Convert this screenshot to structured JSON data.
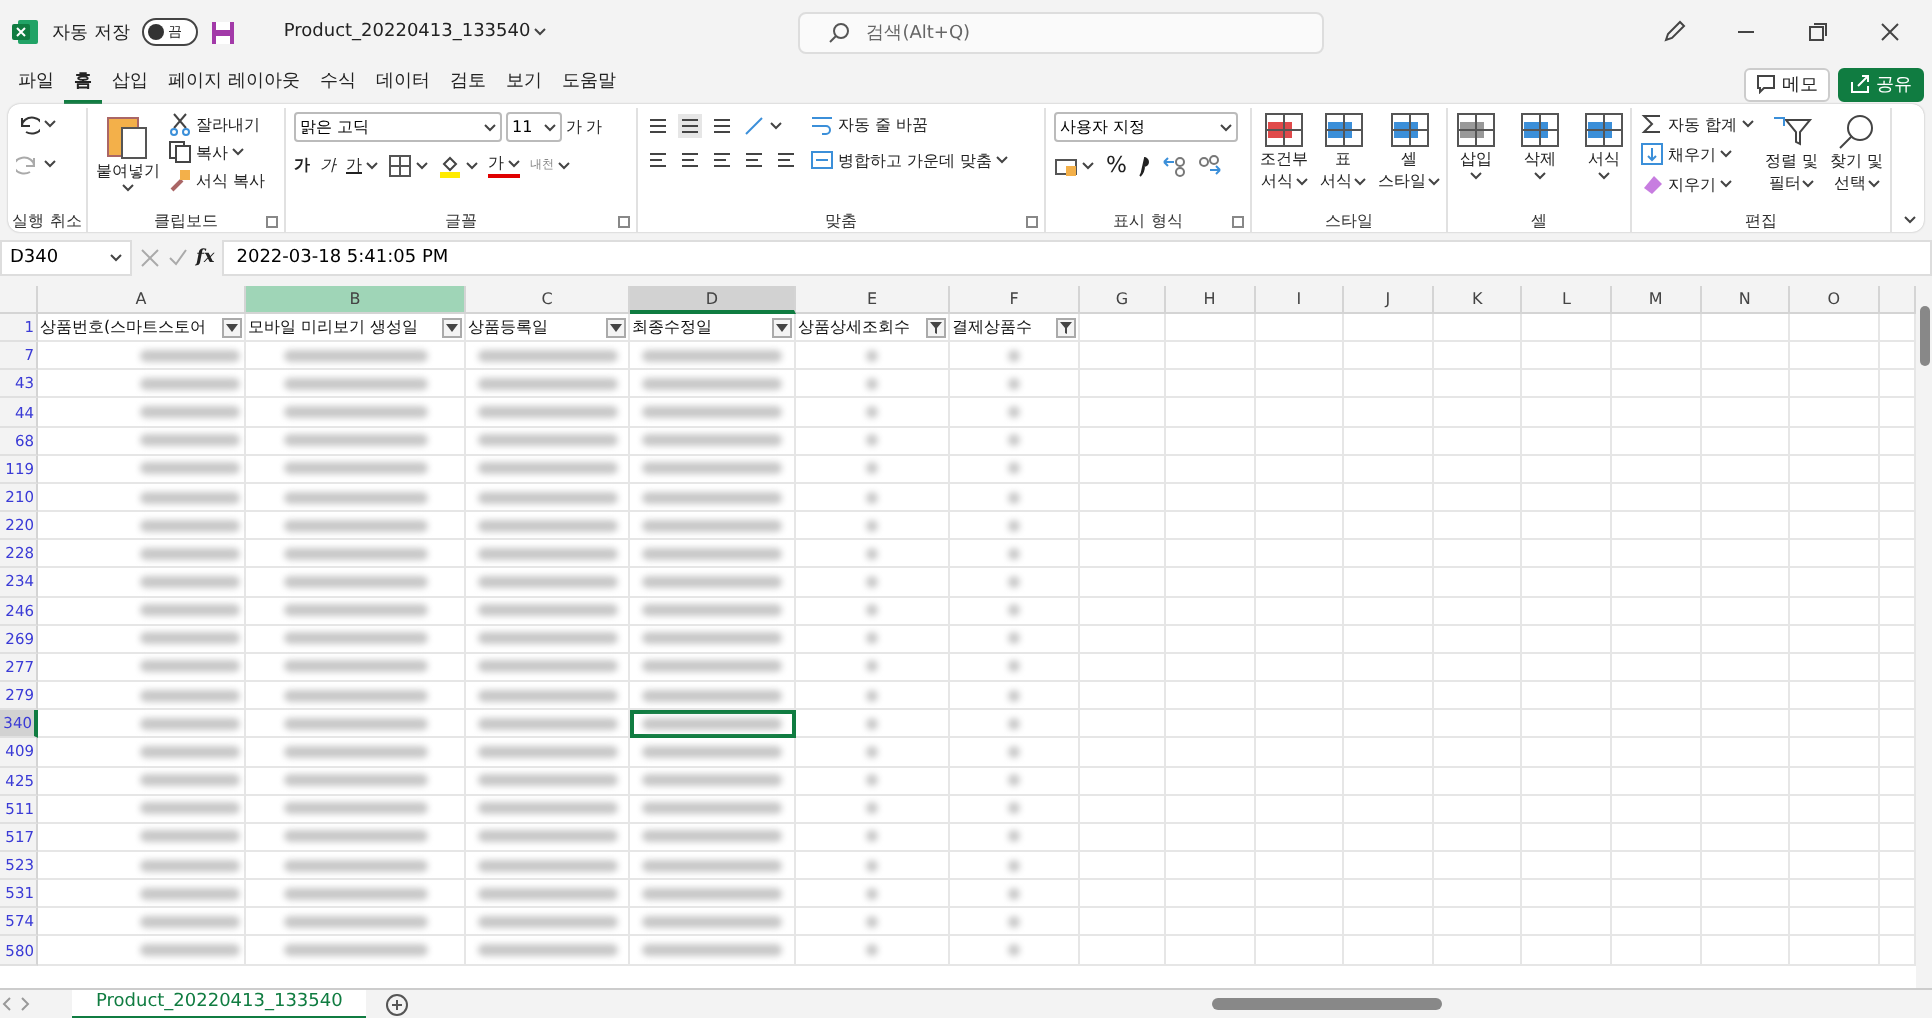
{
  "title_bar": {
    "autosave_label": "자동 저장",
    "autosave": {
      "on": false,
      "label": "끔"
    },
    "filename": "Product_20220413_133540",
    "search": {
      "placeholder": "검색(Alt+Q)"
    }
  },
  "menu_tabs": [
    {
      "label": "파일",
      "selected": false
    },
    {
      "label": "홈",
      "selected": true
    },
    {
      "label": "삽입",
      "selected": false
    },
    {
      "label": "페이지 레이아웃",
      "selected": false
    },
    {
      "label": "수식",
      "selected": false
    },
    {
      "label": "데이터",
      "selected": false
    },
    {
      "label": "검토",
      "selected": false
    },
    {
      "label": "보기",
      "selected": false
    },
    {
      "label": "도움말",
      "selected": false
    }
  ],
  "header_buttons": [
    {
      "kind": "comment",
      "label": "메모"
    },
    {
      "kind": "share",
      "label": "공유"
    }
  ],
  "ribbon": [
    {
      "kind": "undo",
      "label": "실행 취소"
    },
    {
      "kind": "clipboard",
      "label": "클립보드",
      "texts": [
        "붙여넣기",
        "잘라내기",
        "복사",
        "서식 복사"
      ]
    },
    {
      "kind": "font",
      "label": "글꼴",
      "texts": [
        "맑은 고딕",
        "11",
        "가",
        "가",
        "가",
        "가",
        "가",
        "가",
        "내천"
      ]
    },
    {
      "kind": "alignment",
      "label": "맞춤",
      "texts": [
        "자동 줄 바꿈",
        "병합하고 가운데 맞춤"
      ]
    },
    {
      "kind": "number",
      "label": "표시 형식",
      "texts": [
        "사용자 지정",
        "%"
      ]
    },
    {
      "kind": "styles",
      "label": "스타일",
      "texts": [
        "조건부",
        "서식",
        "표",
        "서식",
        "셀",
        "스타일"
      ]
    },
    {
      "kind": "cells",
      "label": "셀",
      "texts": [
        "삽입",
        "삭제",
        "서식"
      ]
    },
    {
      "kind": "editing",
      "label": "편집",
      "texts": [
        "자동 합계",
        "채우기",
        "지우기",
        "정렬 및",
        "필터",
        "찾기 및",
        "선택"
      ]
    }
  ],
  "formula_bar": {
    "name_box": "D340",
    "fx_label": "fx",
    "formula": "2022-03-18  5:41:05 PM"
  },
  "columns": [
    {
      "letter": "A",
      "selected": false,
      "active": false
    },
    {
      "letter": "B",
      "selected": true,
      "active": false
    },
    {
      "letter": "C",
      "selected": false,
      "active": false
    },
    {
      "letter": "D",
      "selected": false,
      "active": true
    },
    {
      "letter": "E",
      "selected": false,
      "active": false
    },
    {
      "letter": "F",
      "selected": false,
      "active": false
    },
    {
      "letter": "G",
      "selected": false,
      "active": false
    },
    {
      "letter": "H",
      "selected": false,
      "active": false
    },
    {
      "letter": "I",
      "selected": false,
      "active": false
    },
    {
      "letter": "J",
      "selected": false,
      "active": false
    },
    {
      "letter": "K",
      "selected": false,
      "active": false
    },
    {
      "letter": "L",
      "selected": false,
      "active": false
    },
    {
      "letter": "M",
      "selected": false,
      "active": false
    },
    {
      "letter": "N",
      "selected": false,
      "active": false
    },
    {
      "letter": "O",
      "selected": false,
      "active": false
    }
  ],
  "header_row": {
    "number": "1",
    "cells": [
      {
        "text": "상품번호(스마트스토어",
        "filtered": false
      },
      {
        "text": "모바일 미리보기 생성일",
        "filtered": false
      },
      {
        "text": "상품등록일",
        "filtered": false
      },
      {
        "text": "최종수정일",
        "filtered": false
      },
      {
        "text": "상품상세조회수",
        "filtered": true
      },
      {
        "text": "결제상품수",
        "filtered": true
      }
    ]
  },
  "rows": [
    {
      "number": "7",
      "active": false
    },
    {
      "number": "43",
      "active": false
    },
    {
      "number": "44",
      "active": false
    },
    {
      "number": "68",
      "active": false
    },
    {
      "number": "119",
      "active": false
    },
    {
      "number": "210",
      "active": false
    },
    {
      "number": "220",
      "active": false
    },
    {
      "number": "228",
      "active": false
    },
    {
      "number": "234",
      "active": false
    },
    {
      "number": "246",
      "active": false
    },
    {
      "number": "269",
      "active": false
    },
    {
      "number": "277",
      "active": false
    },
    {
      "number": "279",
      "active": false
    },
    {
      "number": "340",
      "active": true
    },
    {
      "number": "409",
      "active": false
    },
    {
      "number": "425",
      "active": false
    },
    {
      "number": "511",
      "active": false
    },
    {
      "number": "517",
      "active": false
    },
    {
      "number": "523",
      "active": false
    },
    {
      "number": "531",
      "active": false
    },
    {
      "number": "574",
      "active": false
    },
    {
      "number": "580",
      "active": false
    }
  ],
  "sheet_tabs": [
    {
      "label": "Product_20220413_133540",
      "selected": true
    }
  ]
}
